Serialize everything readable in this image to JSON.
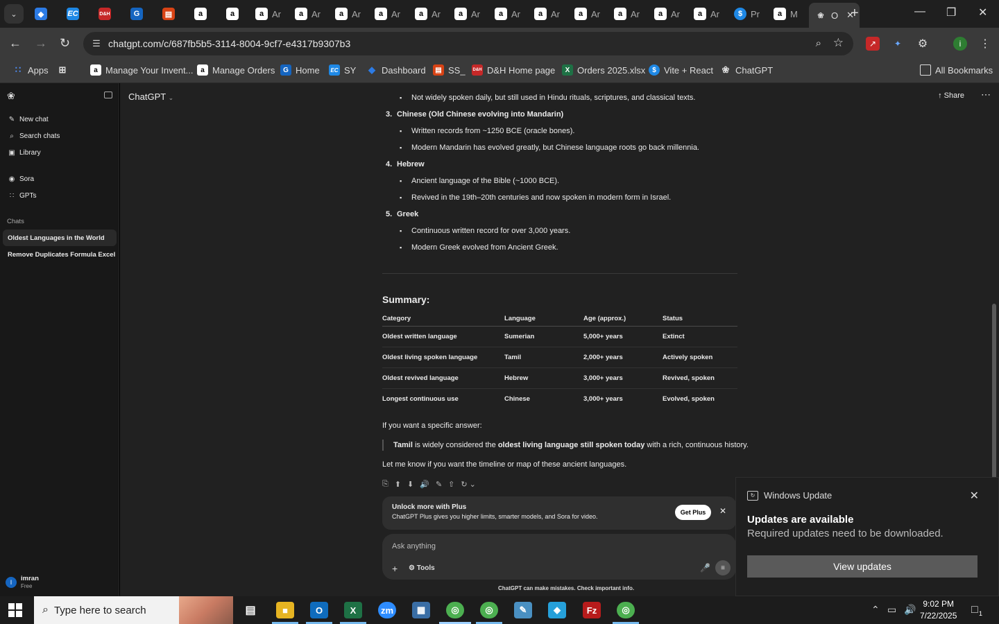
{
  "browser": {
    "tabs": [
      {
        "label": "",
        "favicon": "diamond"
      },
      {
        "label": "",
        "favicon": "EC"
      },
      {
        "label": "",
        "favicon": "D&H"
      },
      {
        "label": "",
        "favicon": "G"
      },
      {
        "label": "",
        "favicon": "box"
      },
      {
        "label": "",
        "favicon": "a"
      },
      {
        "label": "",
        "favicon": "a"
      },
      {
        "label": "Ar",
        "favicon": "a"
      },
      {
        "label": "Ar",
        "favicon": "a"
      },
      {
        "label": "Ar",
        "favicon": "a"
      },
      {
        "label": "Ar",
        "favicon": "a"
      },
      {
        "label": "Ar",
        "favicon": "a"
      },
      {
        "label": "Ar",
        "favicon": "a"
      },
      {
        "label": "Ar",
        "favicon": "a"
      },
      {
        "label": "Ar",
        "favicon": "a"
      },
      {
        "label": "Ar",
        "favicon": "a"
      },
      {
        "label": "Ar",
        "favicon": "a"
      },
      {
        "label": "Ar",
        "favicon": "a"
      },
      {
        "label": "Ar",
        "favicon": "a"
      },
      {
        "label": "Pr",
        "favicon": "$"
      },
      {
        "label": "M",
        "favicon": "a"
      },
      {
        "label": "O",
        "favicon": "openai",
        "active": true
      }
    ],
    "url": "chatgpt.com/c/687fb5b5-3114-8004-9cf7-e4317b9307b3",
    "bookmarks": [
      {
        "label": "Apps",
        "icon": "apps-grid"
      },
      {
        "label": "",
        "icon": "grid"
      },
      {
        "label": "Manage Your Invent...",
        "icon": "a"
      },
      {
        "label": "Manage Orders",
        "icon": "a"
      },
      {
        "label": "Home",
        "icon": "G"
      },
      {
        "label": "SY",
        "icon": "EC"
      },
      {
        "label": "Dashboard",
        "icon": "diamond"
      },
      {
        "label": "SS_",
        "icon": "box"
      },
      {
        "label": "D&H Home page",
        "icon": "D&H"
      },
      {
        "label": "Orders 2025.xlsx",
        "icon": "X"
      },
      {
        "label": "Vite + React",
        "icon": "$"
      },
      {
        "label": "ChatGPT",
        "icon": "openai"
      }
    ],
    "all_bookmarks": "All Bookmarks"
  },
  "sidebar": {
    "nav": [
      {
        "label": "New chat",
        "icon": "edit-icon"
      },
      {
        "label": "Search chats",
        "icon": "search-icon"
      },
      {
        "label": "Library",
        "icon": "library-icon"
      },
      {
        "label": "Sora",
        "icon": "sora-icon"
      },
      {
        "label": "GPTs",
        "icon": "gpts-icon"
      }
    ],
    "chats_heading": "Chats",
    "chats": [
      {
        "label": "Oldest Languages in the World",
        "active": true
      },
      {
        "label": "Remove Duplicates Formula Excel",
        "active": false
      }
    ],
    "user": {
      "name": "imran",
      "plan": "Free",
      "initial": "I"
    }
  },
  "header": {
    "model": "ChatGPT",
    "share": "Share"
  },
  "answer": {
    "top_bullet": "Not widely spoken daily, but still used in Hindu rituals, scriptures, and classical texts.",
    "items": [
      {
        "num": "3.",
        "title": "Chinese (Old Chinese evolving into Mandarin)",
        "bullets": [
          "Written records from ~1250 BCE (oracle bones).",
          "Modern Mandarin has evolved greatly, but Chinese language roots go back millennia."
        ]
      },
      {
        "num": "4.",
        "title": "Hebrew",
        "bullets": [
          "Ancient language of the Bible (~1000 BCE).",
          "Revived in the 19th–20th centuries and now spoken in modern form in Israel."
        ]
      },
      {
        "num": "5.",
        "title": "Greek",
        "bullets": [
          "Continuous written record for over 3,000 years.",
          "Modern Greek evolved from Ancient Greek."
        ]
      }
    ],
    "summary_title": "Summary:",
    "table": {
      "headers": [
        "Category",
        "Language",
        "Age (approx.)",
        "Status"
      ],
      "rows": [
        [
          "Oldest written language",
          "Sumerian",
          "5,000+ years",
          "Extinct"
        ],
        [
          "Oldest living spoken language",
          "Tamil",
          "2,000+ years",
          "Actively spoken"
        ],
        [
          "Oldest revived language",
          "Hebrew",
          "3,000+ years",
          "Revived, spoken"
        ],
        [
          "Longest continuous use",
          "Chinese",
          "3,000+ years",
          "Evolved, spoken"
        ]
      ]
    },
    "specific": "If you want a specific answer:",
    "quote_b1": "Tamil",
    "quote_t1": " is widely considered the ",
    "quote_b2": "oldest living language still spoken today",
    "quote_t2": " with a rich, continuous history.",
    "closing": "Let me know if you want the timeline or map of these ancient languages."
  },
  "plus_banner": {
    "title": "Unlock more with Plus",
    "desc": "ChatGPT Plus gives you higher limits, smarter models, and Sora for video.",
    "button": "Get Plus"
  },
  "composer": {
    "placeholder": "Ask anything",
    "tools": "Tools"
  },
  "disclaimer": "ChatGPT can make mistakes. Check important info.",
  "toast": {
    "app": "Windows Update",
    "title": "Updates are available",
    "message": "Required updates need to be downloaded.",
    "button": "View updates"
  },
  "taskbar": {
    "search_placeholder": "Type here to search",
    "time": "9:02 PM",
    "date": "7/22/2025",
    "notifications": "1"
  }
}
